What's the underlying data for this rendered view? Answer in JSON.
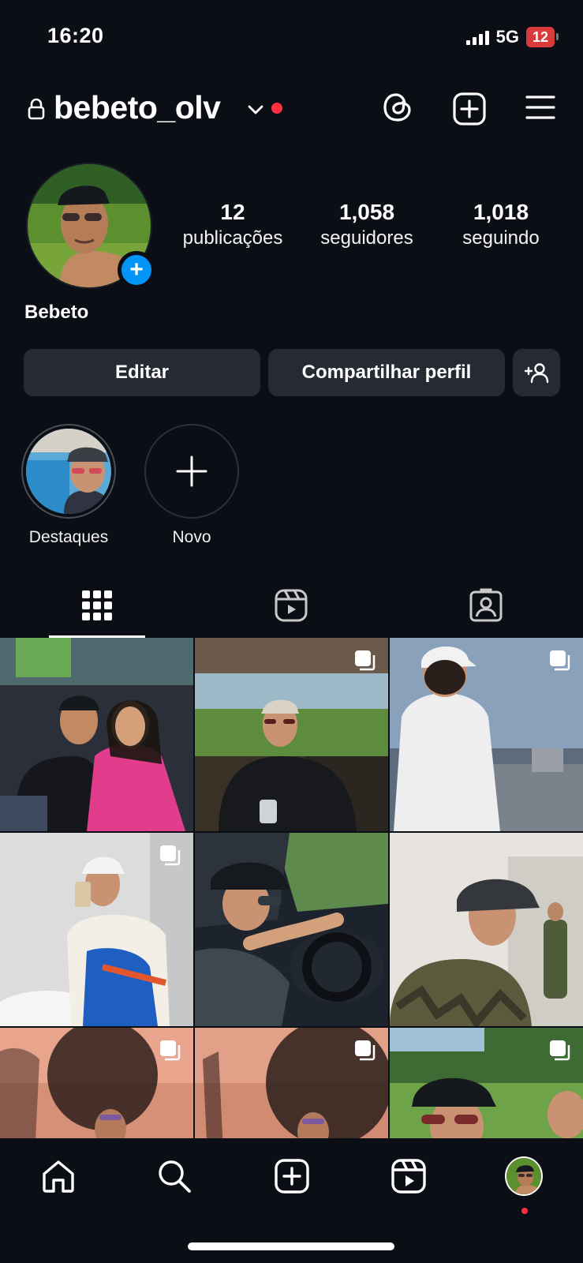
{
  "status_bar": {
    "time": "16:20",
    "network": "5G",
    "battery": "12"
  },
  "header": {
    "username": "bebeto_olv",
    "icons": [
      "lock-icon",
      "chevron-down-icon",
      "threads-icon",
      "add-post-icon",
      "menu-icon"
    ],
    "notification_color": "#ff3040"
  },
  "profile": {
    "display_name": "Bebeto",
    "stats": [
      {
        "value": "12",
        "label": "publicações"
      },
      {
        "value": "1,058",
        "label": "seguidores"
      },
      {
        "value": "1,018",
        "label": "seguindo"
      }
    ],
    "avatar_add_glyph": "+",
    "accent_color": "#0095f6"
  },
  "buttons": {
    "edit": "Editar",
    "share": "Compartilhar perfil"
  },
  "highlights": [
    {
      "label": "Destaques"
    },
    {
      "label": "Novo"
    }
  ],
  "tabs": [
    "grid-icon",
    "reels-icon",
    "tagged-icon"
  ],
  "grid": {
    "posts": [
      {
        "multi": false
      },
      {
        "multi": true
      },
      {
        "multi": true
      },
      {
        "multi": true
      },
      {
        "multi": false
      },
      {
        "multi": false
      },
      {
        "multi": true
      },
      {
        "multi": true
      },
      {
        "multi": true
      }
    ]
  },
  "bottom_nav": [
    "home-icon",
    "search-icon",
    "create-icon",
    "reels-icon",
    "profile-avatar"
  ]
}
